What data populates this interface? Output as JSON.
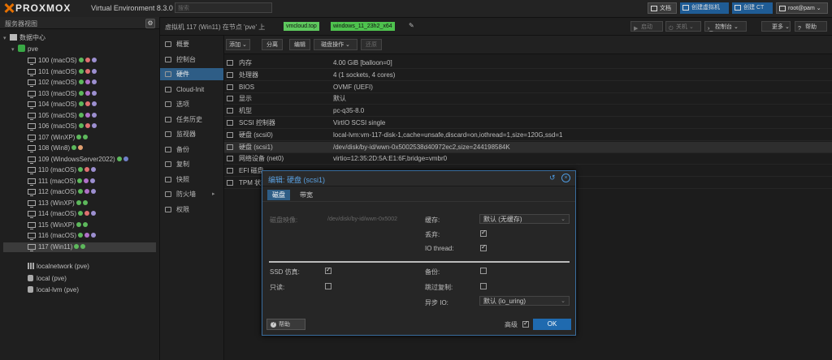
{
  "topbar": {
    "logo": "PROXMOX",
    "product": "Virtual Environment 8.3.0",
    "search_placeholder": "搜索",
    "docs": "文档",
    "create_vm": "创建虚拟机",
    "create_ct": "创建 CT",
    "user": "root@pam"
  },
  "sidebar": {
    "header": "服务器视图",
    "datacenter": "数据中心",
    "node": "pve",
    "vms": [
      {
        "label": "100 (macOS)",
        "dots": [
          "#5db85c",
          "#e07070",
          "#9c8fd0"
        ]
      },
      {
        "label": "101 (macOS)",
        "dots": [
          "#5db85c",
          "#e07070",
          "#9c8fd0"
        ]
      },
      {
        "label": "102 (macOS)",
        "dots": [
          "#5db85c",
          "#b070c8",
          "#9c8fd0"
        ]
      },
      {
        "label": "103 (macOS)",
        "dots": [
          "#5db85c",
          "#b070c8",
          "#9c8fd0"
        ]
      },
      {
        "label": "104 (macOS)",
        "dots": [
          "#5db85c",
          "#e07070",
          "#9c8fd0"
        ]
      },
      {
        "label": "105 (macOS)",
        "dots": [
          "#5db85c",
          "#b070c8",
          "#9c8fd0"
        ]
      },
      {
        "label": "106 (macOS)",
        "dots": [
          "#5db85c",
          "#e07070",
          "#9c8fd0"
        ]
      },
      {
        "label": "107 (WinXP)",
        "dots": [
          "#5db85c",
          "#5db85c"
        ]
      },
      {
        "label": "108 (Win8)",
        "dots": [
          "#5db85c",
          "#e0a070"
        ]
      },
      {
        "label": "109 (WindowsServer2022)",
        "dots": [
          "#5db85c",
          "#7080c8"
        ]
      },
      {
        "label": "110 (macOS)",
        "dots": [
          "#5db85c",
          "#e07070",
          "#9c8fd0"
        ]
      },
      {
        "label": "111 (macOS)",
        "dots": [
          "#5db85c",
          "#b070c8",
          "#9c8fd0"
        ]
      },
      {
        "label": "112 (macOS)",
        "dots": [
          "#5db85c",
          "#b070c8",
          "#9c8fd0"
        ]
      },
      {
        "label": "113 (WinXP)",
        "dots": [
          "#5db85c",
          "#5db85c"
        ]
      },
      {
        "label": "114 (macOS)",
        "dots": [
          "#5db85c",
          "#e07070",
          "#9c8fd0"
        ]
      },
      {
        "label": "115 (WinXP)",
        "dots": [
          "#5db85c",
          "#5db85c"
        ]
      },
      {
        "label": "116 (macOS)",
        "dots": [
          "#5db85c",
          "#b070c8",
          "#9c8fd0"
        ]
      },
      {
        "label": "117 (Win11)",
        "dots": [
          "#5db85c",
          "#5db85c"
        ]
      }
    ],
    "storages": [
      "localnetwork (pve)",
      "local (pve)",
      "local-lvm (pve)"
    ]
  },
  "breadcrumb": {
    "title": "虚拟机 117 (Win11) 在节点 'pve' 上",
    "tag1": "vmcloud.top",
    "tag2": "windows_11_23h2_x64",
    "start": "启动",
    "shutdown": "关机",
    "console": "控制台",
    "more": "更多",
    "help": "帮助"
  },
  "nav": [
    {
      "label": "概要"
    },
    {
      "label": "控制台"
    },
    {
      "label": "硬件"
    },
    {
      "label": "Cloud-Init"
    },
    {
      "label": "选项"
    },
    {
      "label": "任务历史"
    },
    {
      "label": "监视器"
    },
    {
      "label": "备份"
    },
    {
      "label": "复制"
    },
    {
      "label": "快照"
    },
    {
      "label": "防火墙"
    },
    {
      "label": "权限"
    }
  ],
  "content": {
    "add": "添加",
    "remove": "分离",
    "edit": "编辑",
    "disk_action": "磁盘操作",
    "revert": "还原"
  },
  "hardware": [
    {
      "label": "内存",
      "value": "4.00 GiB [balloon=0]"
    },
    {
      "label": "处理器",
      "value": "4 (1 sockets, 4 cores)"
    },
    {
      "label": "BIOS",
      "value": "OVMF (UEFI)"
    },
    {
      "label": "显示",
      "value": "默认"
    },
    {
      "label": "机型",
      "value": "pc-q35-8.0"
    },
    {
      "label": "SCSI 控制器",
      "value": "VirtIO SCSI single"
    },
    {
      "label": "硬盘 (scsi0)",
      "value": "local-lvm:vm-117-disk-1,cache=unsafe,discard=on,iothread=1,size=120G,ssd=1"
    },
    {
      "label": "硬盘 (scsi1)",
      "value": "/dev/disk/by-id/wwn-0x5002538d40972ec2,size=244198584K"
    },
    {
      "label": "网络设备 (net0)",
      "value": "virtio=12:35:2D:5A:E1:6F,bridge=vmbr0"
    },
    {
      "label": "EFI 磁盘",
      "value": ""
    },
    {
      "label": "TPM 状态",
      "value": ""
    }
  ],
  "dialog": {
    "title": "编辑: 硬盘 (scsi1)",
    "tab_disk": "磁盘",
    "tab_bw": "带宽",
    "disk_image_label": "磁盘映像:",
    "disk_image_value": "/dev/disk/by-id/wwn-0x5002",
    "cache_label": "缓存:",
    "cache_value": "默认 (无缓存)",
    "discard_label": "丢弃:",
    "iothread_label": "IO thread:",
    "ssd_label": "SSD 仿真:",
    "readonly_label": "只读:",
    "backup_label": "备份:",
    "skip_repl_label": "跳过复制:",
    "async_io_label": "异步 IO:",
    "async_io_value": "默认 (io_uring)",
    "help": "帮助",
    "advanced": "高级",
    "ok": "OK"
  }
}
